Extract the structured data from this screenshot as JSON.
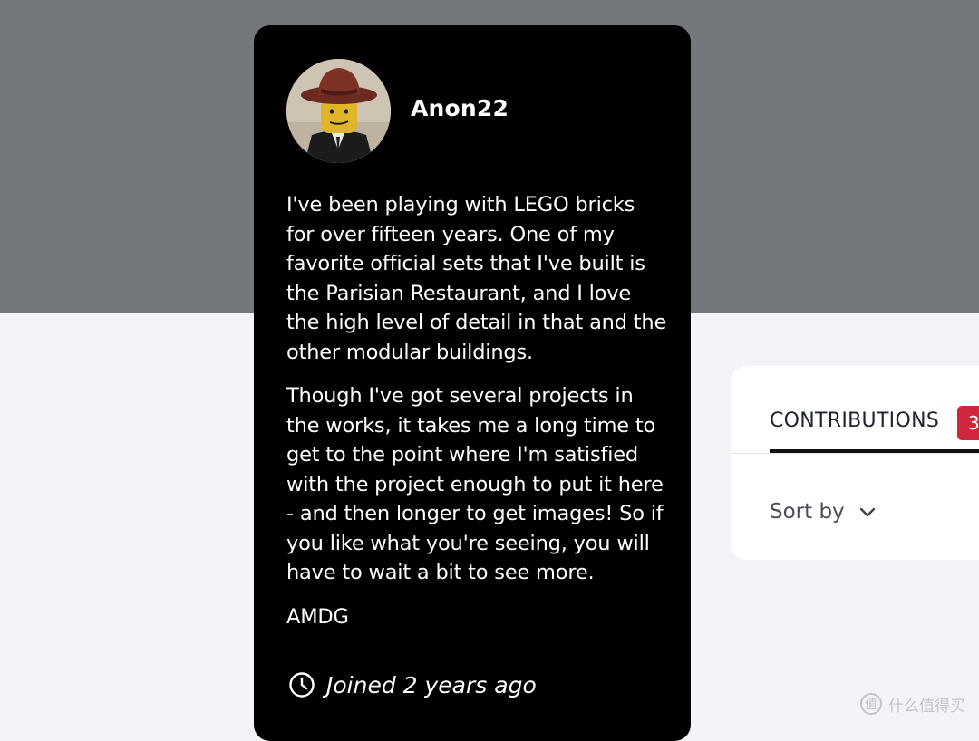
{
  "profile": {
    "username": "Anon22",
    "bio": [
      "I've been playing with LEGO bricks for over fifteen years. One of my favorite official sets that I've built is the Parisian Restaurant, and I love the high level of detail in that and the other modular buildings.",
      "Though I've got several projects in the works, it takes me a long time to get to the point where I'm satisfied with the project enough to put it here - and then longer to get images! So if you like what you're seeing, you will have to wait a bit to see more.",
      "AMDG"
    ],
    "joined": "Joined 2 years ago",
    "icons": {
      "joined": "clock-icon",
      "avatar": "lego-minifigure-avatar"
    }
  },
  "contributions": {
    "tab_label": "CONTRIBUTIONS",
    "count": "3",
    "sort_label": "Sort by",
    "sort_icon": "chevron-down-icon"
  },
  "watermark": {
    "text": "什么值得买"
  },
  "colors": {
    "header_band": "#74777c",
    "page_background": "#f3f4f8",
    "card_background": "#000000",
    "badge": "#d1273c"
  }
}
